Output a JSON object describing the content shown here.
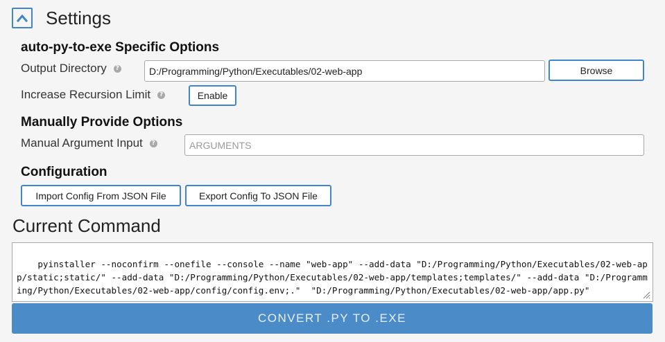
{
  "settings": {
    "title": "Settings",
    "toggle_icon": "chevron-up-icon"
  },
  "specific_options": {
    "title": "auto-py-to-exe Specific Options",
    "output_directory": {
      "label": "Output Directory",
      "value": "D:/Programming/Python/Executables/02-web-app",
      "browse_label": "Browse"
    },
    "recursion": {
      "label": "Increase Recursion Limit",
      "button_label": "Enable"
    }
  },
  "manual_options": {
    "title": "Manually Provide Options",
    "argument_input": {
      "label": "Manual Argument Input",
      "placeholder": "ARGUMENTS",
      "value": ""
    }
  },
  "configuration": {
    "title": "Configuration",
    "import_label": "Import Config From JSON File",
    "export_label": "Export Config To JSON File"
  },
  "help_icon_glyph": "?",
  "current_command": {
    "title": "Current Command",
    "text": "pyinstaller --noconfirm --onefile --console --name \"web-app\" --add-data \"D:/Programming/Python/Executables/02-web-app/static;static/\" --add-data \"D:/Programming/Python/Executables/02-web-app/templates;templates/\" --add-data \"D:/Programming/Python/Executables/02-web-app/config/config.env;.\"  \"D:/Programming/Python/Executables/02-web-app/app.py\""
  },
  "convert_button": {
    "label": "CONVERT .PY TO .EXE"
  },
  "colors": {
    "accent": "#3f85c8",
    "convert_bg": "#4a8bc8",
    "page_bg": "#f5f5f5"
  }
}
